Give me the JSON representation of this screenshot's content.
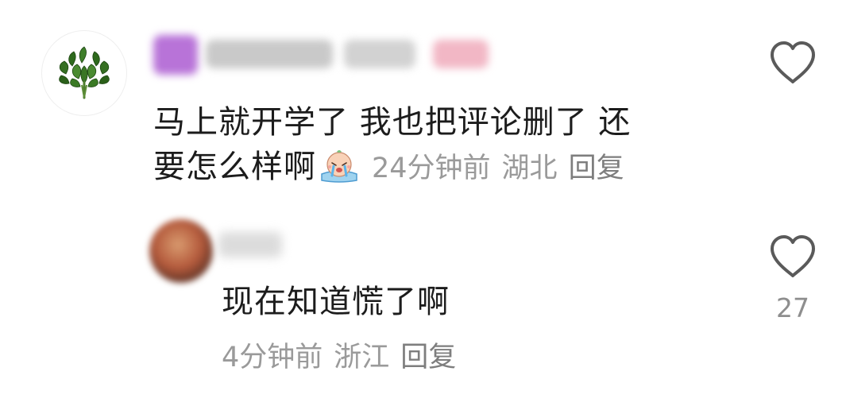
{
  "main_comment": {
    "text_line1": "马上就开学了 我也把评论删了 还",
    "text_line2": "要怎么样啊",
    "emoji": "crying-baby-emoji",
    "time": "24分钟前",
    "location": "湖北",
    "reply_label": "回复"
  },
  "reply": {
    "text": "现在知道慌了啊",
    "time": "4分钟前",
    "location": "浙江",
    "reply_label": "回复",
    "like_count": "27"
  },
  "colors": {
    "text": "#1c1c1c",
    "meta": "#9a9a9a",
    "reply_link": "#7e7e7e",
    "icon_stroke": "#5a5a5a"
  },
  "icons": {
    "like": "heart-outline-icon",
    "main_avatar": "basil-leaves-avatar"
  }
}
